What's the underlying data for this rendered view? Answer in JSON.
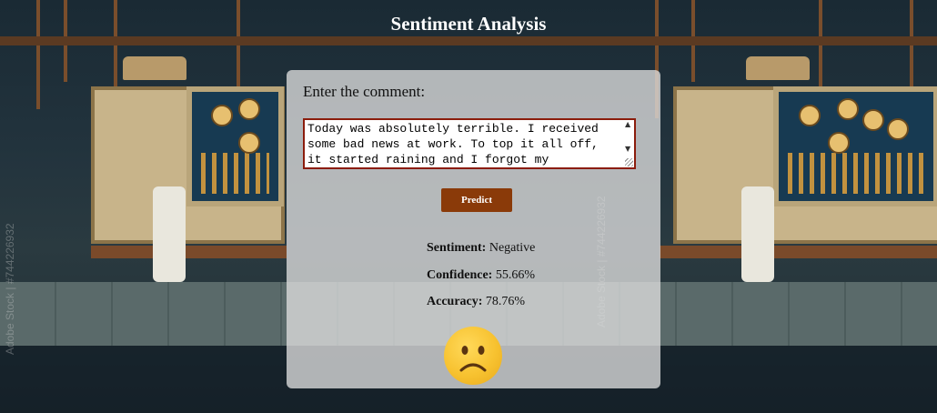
{
  "page": {
    "title": "Sentiment Analysis"
  },
  "form": {
    "label": "Enter the comment:",
    "comment_value": "Today was absolutely terrible. I received some bad news at work. To top it all off, it started raining and I forgot my umbrella. I'm feeling really down and frustrated.",
    "predict_label": "Predict"
  },
  "result": {
    "sentiment_label": "Sentiment:",
    "sentiment_value": "Negative",
    "confidence_label": "Confidence:",
    "confidence_value": "55.66%",
    "accuracy_label": "Accuracy:",
    "accuracy_value": "78.76%",
    "emoji_icon": "frowning-face-icon"
  },
  "background": {
    "watermark": "Adobe Stock | #744226932"
  },
  "colors": {
    "button": "#8a3a09",
    "textarea_border": "#8b1c0c",
    "card": "rgba(222,222,222,0.78)"
  }
}
